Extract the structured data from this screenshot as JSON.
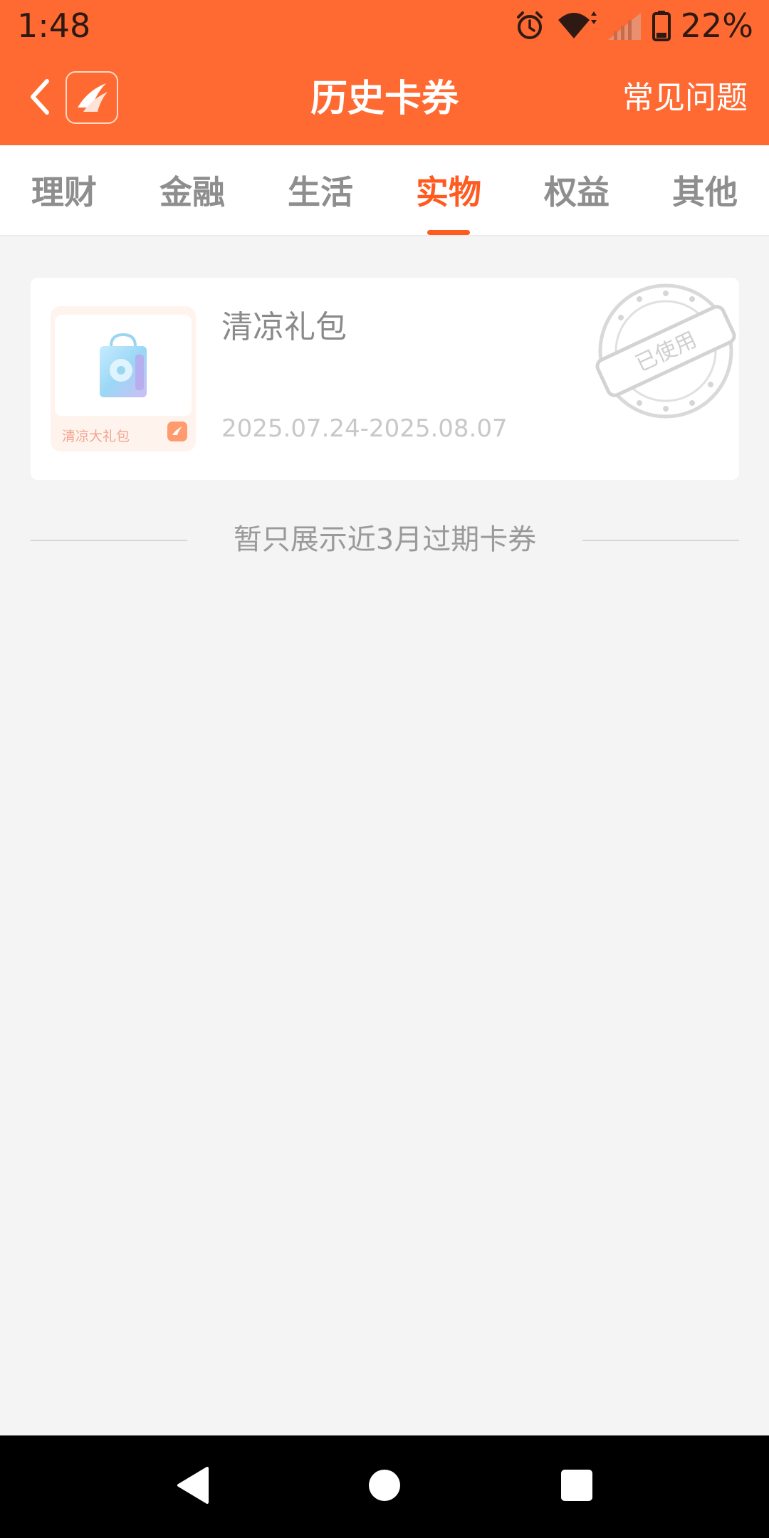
{
  "status_bar": {
    "time": "1:48",
    "battery_percent": "22%",
    "icons": [
      "alarm-icon",
      "wifi-icon",
      "signal-icon",
      "battery-icon"
    ]
  },
  "header": {
    "title": "历史卡券",
    "faq_label": "常见问题",
    "back_icon": "chevron-left-icon",
    "logo_icon": "app-logo-icon"
  },
  "tabs": [
    {
      "label": "理财",
      "active": false
    },
    {
      "label": "金融",
      "active": false
    },
    {
      "label": "生活",
      "active": false
    },
    {
      "label": "实物",
      "active": true
    },
    {
      "label": "权益",
      "active": false
    },
    {
      "label": "其他",
      "active": false
    }
  ],
  "coupons": [
    {
      "title": "清凉礼包",
      "date_range": "2025.07.24-2025.08.07",
      "thumb_label": "清凉大礼包",
      "stamp_text": "已使用"
    }
  ],
  "notice": {
    "text": "暂只展示近3月过期卡券"
  },
  "nav": {
    "icons": [
      "back-triangle-icon",
      "home-circle-icon",
      "recents-square-icon"
    ]
  },
  "colors": {
    "brand": "#ff6a33",
    "active_tab": "#ff5a1f",
    "background": "#f4f4f4"
  }
}
